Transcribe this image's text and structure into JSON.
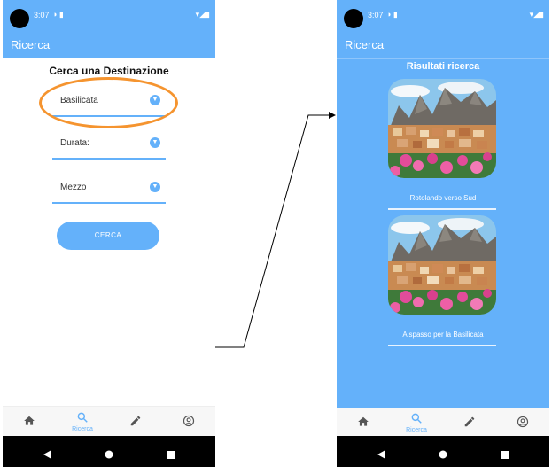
{
  "status_bar": {
    "time": "3:07"
  },
  "left_screen": {
    "appbar_title": "Ricerca",
    "form_title": "Cerca una Destinazione",
    "fields": [
      {
        "value": "Basilicata"
      },
      {
        "value": "Durata:"
      },
      {
        "value": "Mezzo"
      }
    ],
    "search_button": "CERCA"
  },
  "right_screen": {
    "appbar_title": "Ricerca",
    "results_title": "Risultati ricerca",
    "results": [
      {
        "label": "Rotolando verso Sud"
      },
      {
        "label": "A spasso per la Basilicata"
      }
    ]
  },
  "bottom_nav": {
    "active_label": "Ricerca",
    "items": [
      "home-icon",
      "search-icon",
      "edit-icon",
      "account-icon"
    ]
  },
  "colors": {
    "primary": "#64b1fa",
    "highlight": "#f5942f"
  }
}
